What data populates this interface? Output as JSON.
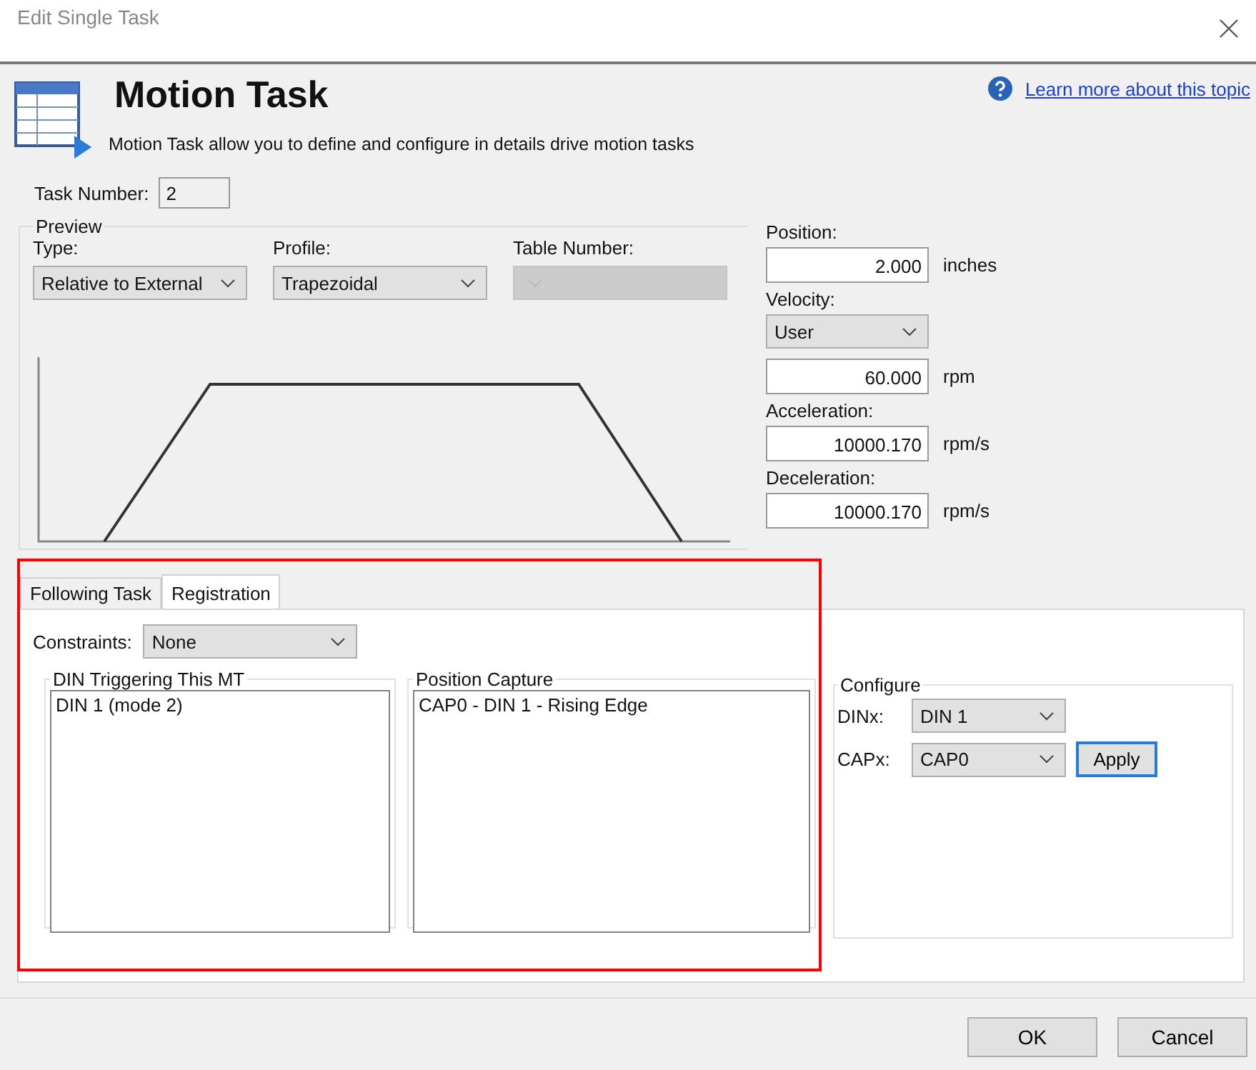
{
  "window": {
    "title": "Edit Single Task"
  },
  "header": {
    "title": "Motion Task",
    "description": "Motion Task allow you to define and configure in details drive motion tasks",
    "help_link": "Learn more about this topic"
  },
  "task_number": {
    "label": "Task Number:",
    "value": "2"
  },
  "preview": {
    "title": "Preview",
    "dropdowns": [
      {
        "label": "Type:",
        "value": "Relative to External",
        "disabled": false
      },
      {
        "label": "Profile:",
        "value": "Trapezoidal",
        "disabled": false
      },
      {
        "label": "Table Number:",
        "disabled": true
      }
    ]
  },
  "motion": {
    "fields": [
      {
        "kind": "input",
        "label": "Position:",
        "value": "2.000",
        "unit": "inches"
      },
      {
        "kind": "select",
        "label": "Velocity:",
        "value": "User"
      },
      {
        "kind": "input",
        "value": "60.000",
        "unit": "rpm"
      },
      {
        "kind": "input",
        "label": "Acceleration:",
        "value": "10000.170",
        "unit": "rpm/s"
      },
      {
        "kind": "input",
        "label": "Deceleration:",
        "value": "10000.170",
        "unit": "rpm/s"
      }
    ]
  },
  "tabs": [
    {
      "label": "Following Task",
      "selected": false
    },
    {
      "label": "Registration",
      "selected": true
    }
  ],
  "registration": {
    "constraints": {
      "label": "Constraints:",
      "value": "None"
    },
    "lists": [
      {
        "title": "DIN Triggering This MT",
        "items": [
          "DIN 1 (mode 2)"
        ]
      },
      {
        "title": "Position Capture",
        "items": [
          "CAP0 - DIN 1 - Rising Edge"
        ]
      }
    ],
    "configure": {
      "title": "Configure",
      "dropdowns": [
        {
          "label": "DINx:",
          "value": "DIN 1"
        },
        {
          "label": "CAPx:",
          "value": "CAP0"
        }
      ],
      "apply": "Apply"
    }
  },
  "buttons": [
    "OK",
    "Cancel"
  ]
}
